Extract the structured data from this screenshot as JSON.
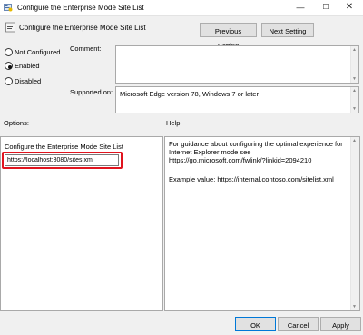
{
  "window": {
    "title": "Configure the Enterprise Mode Site List",
    "icon": "policy-settings-icon"
  },
  "header": {
    "title": "Configure the Enterprise Mode Site List",
    "prev_button": "Previous Setting",
    "next_button": "Next Setting"
  },
  "state": {
    "options": [
      {
        "label": "Not Configured",
        "selected": false
      },
      {
        "label": "Enabled",
        "selected": true
      },
      {
        "label": "Disabled",
        "selected": false
      }
    ]
  },
  "comment": {
    "label": "Comment:",
    "value": ""
  },
  "supported": {
    "label": "Supported on:",
    "value": "Microsoft Edge version 78, Windows 7 or later"
  },
  "options_panel": {
    "label": "Options:",
    "title": "Configure the Enterprise Mode Site List",
    "url_value": "https://localhost:8080/sites.xml"
  },
  "help_panel": {
    "label": "Help:",
    "text": "For guidance about configuring the optimal experience for Internet Explorer mode see https://go.microsoft.com/fwlink/?linkid=2094210",
    "example": "Example value: https://internal.contoso.com/sitelist.xml"
  },
  "footer": {
    "ok": "OK",
    "cancel": "Cancel",
    "apply": "Apply"
  },
  "colors": {
    "highlight": "#e0141e",
    "accent": "#0078d7"
  }
}
